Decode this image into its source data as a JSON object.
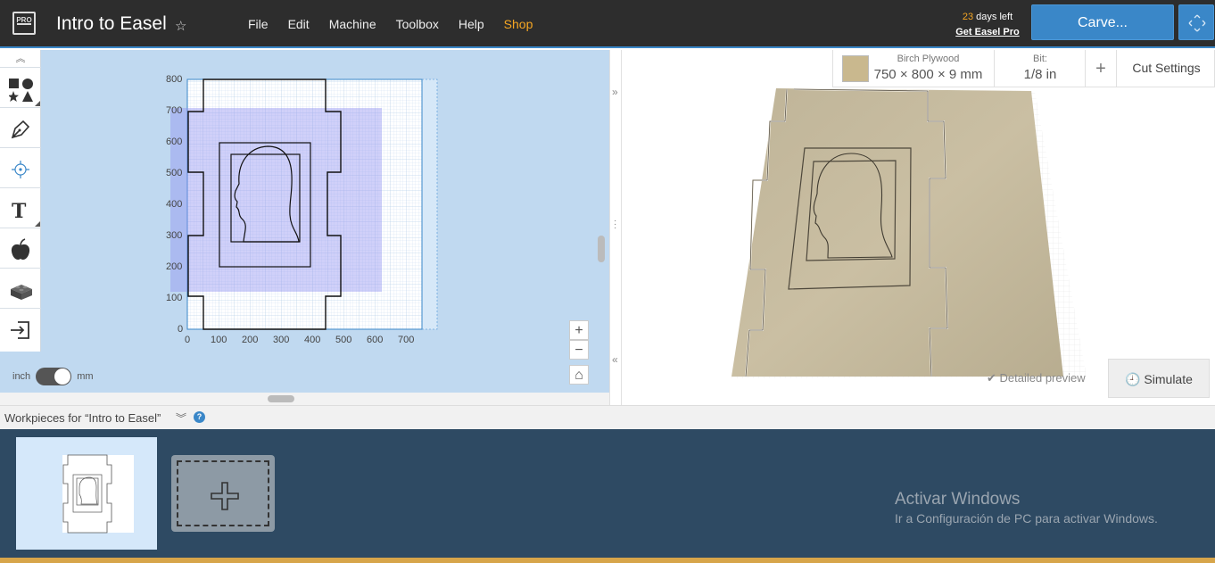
{
  "header": {
    "logo_label": "PRO",
    "project_title": "Intro to Easel",
    "menu": [
      {
        "label": "File"
      },
      {
        "label": "Edit"
      },
      {
        "label": "Machine"
      },
      {
        "label": "Toolbox"
      },
      {
        "label": "Help"
      },
      {
        "label": "Shop"
      }
    ],
    "trial_days": "23",
    "trial_suffix": " days left",
    "upgrade_link": "Get Easel Pro",
    "carve_label": "Carve..."
  },
  "toolbox": {
    "tools": [
      "shapes-tool",
      "pen-tool",
      "point-tool",
      "text-tool",
      "icon-library-tool",
      "apps-tool",
      "import-tool"
    ]
  },
  "canvas": {
    "y_ticks": [
      "800",
      "700",
      "600",
      "500",
      "400",
      "300",
      "200",
      "100",
      "0"
    ],
    "x_ticks": [
      "0",
      "100",
      "200",
      "300",
      "400",
      "500",
      "600",
      "700"
    ]
  },
  "units": {
    "left": "inch",
    "right": "mm"
  },
  "zoom": {
    "in": "+",
    "out": "−",
    "home": "⌂"
  },
  "material": {
    "name": "Birch Plywood",
    "dims": "750 × 800 × 9 mm",
    "swatch_color": "#c9b88e"
  },
  "bit": {
    "label": "Bit:",
    "value": "1/8 in"
  },
  "cut_settings_label": "Cut Settings",
  "preview": {
    "detailed_label": "Detailed preview",
    "simulate_label": "Simulate"
  },
  "workpieces": {
    "title": "Workpieces for “Intro to Easel”"
  },
  "windows_notice": {
    "title": "Activar Windows",
    "subtitle": "Ir a Configuración de PC para activar Windows."
  },
  "colors": {
    "accent": "#3a87c8",
    "shop": "#f5a623",
    "topbar": "#2d2d2d",
    "workpiece_bg": "#2e4a63"
  }
}
